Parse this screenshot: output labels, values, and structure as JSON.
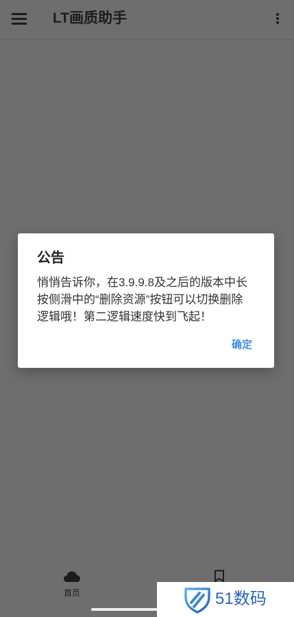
{
  "app_bar": {
    "menu_icon": "menu-icon",
    "title": "LT画质助手",
    "overflow_icon": "more-vert-icon"
  },
  "dialog": {
    "title": "公告",
    "body_lines": [
      "悄悄告诉你，在3.9.9.8及之后的版本中长",
      "按侧滑中的“删除资源”按钮可以切换删除",
      "逻辑哦！第二逻辑速度快到飞起！"
    ],
    "confirm_label": "确定"
  },
  "bottom_nav": {
    "items": [
      {
        "icon": "cloud-icon",
        "label": "首页"
      },
      {
        "icon": "bookmark-icon",
        "label": ""
      }
    ]
  },
  "watermark": {
    "logo_icon": "shield-logo-icon",
    "text": "51数码"
  },
  "colors": {
    "scrim_background": "#6e6e6e",
    "dialog_background": "#ffffff",
    "accent": "#3d8edb",
    "text_primary": "#212121",
    "watermark_blue": "#2b63b5"
  }
}
